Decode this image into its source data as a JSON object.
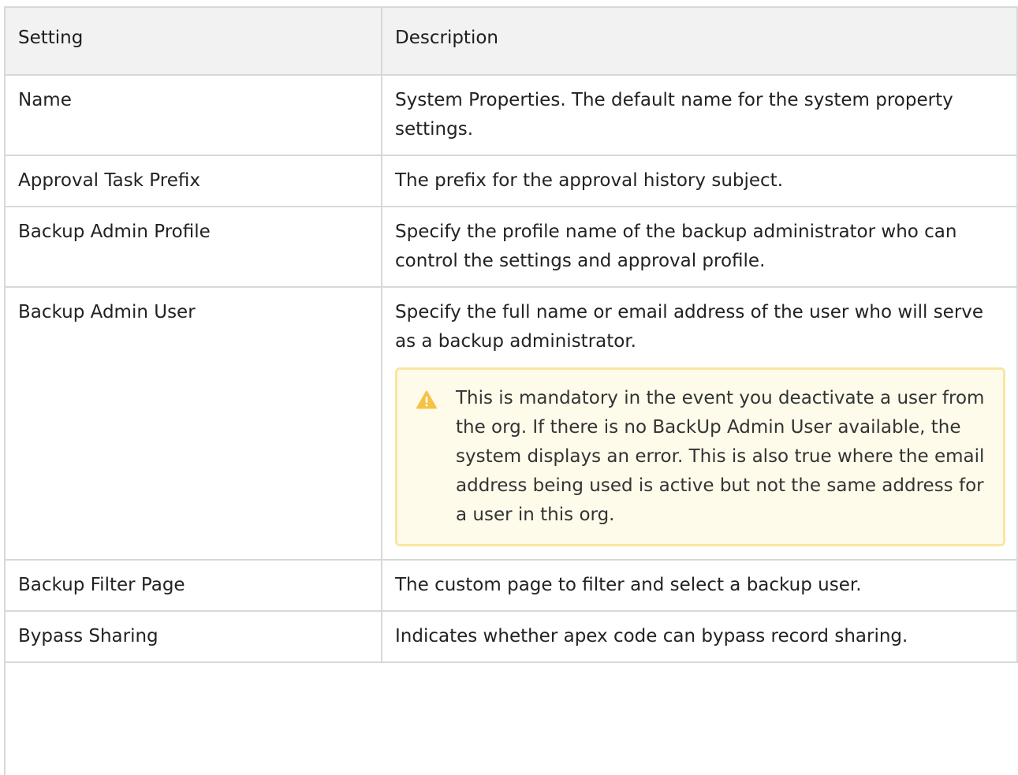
{
  "table": {
    "headers": [
      "Setting",
      "Description"
    ],
    "rows": [
      {
        "setting": "Name",
        "description": "System Properties. The default name for the system property settings."
      },
      {
        "setting": "Approval Task Prefix",
        "description": "The prefix for the approval history subject."
      },
      {
        "setting": "Backup Admin Profile",
        "description": "Specify the profile name of the backup administrator who can control the settings and approval profile."
      },
      {
        "setting": "Backup Admin User",
        "description": "Specify the full name or email address of the user who will serve as a backup administrator."
      },
      {
        "setting": "Backup Filter Page",
        "description": "The custom page to filter and select a backup user."
      },
      {
        "setting": "Bypass Sharing",
        "description": "Indicates whether apex code can bypass record sharing."
      }
    ]
  },
  "note": {
    "icon": "warning-icon",
    "color": "#f5c242",
    "text": "This is mandatory in the event you deactivate a user from the org. If there is no BackUp Admin User available, the system displays an error. This is also true where the email address being used is active but not the same address for a user in this org."
  }
}
